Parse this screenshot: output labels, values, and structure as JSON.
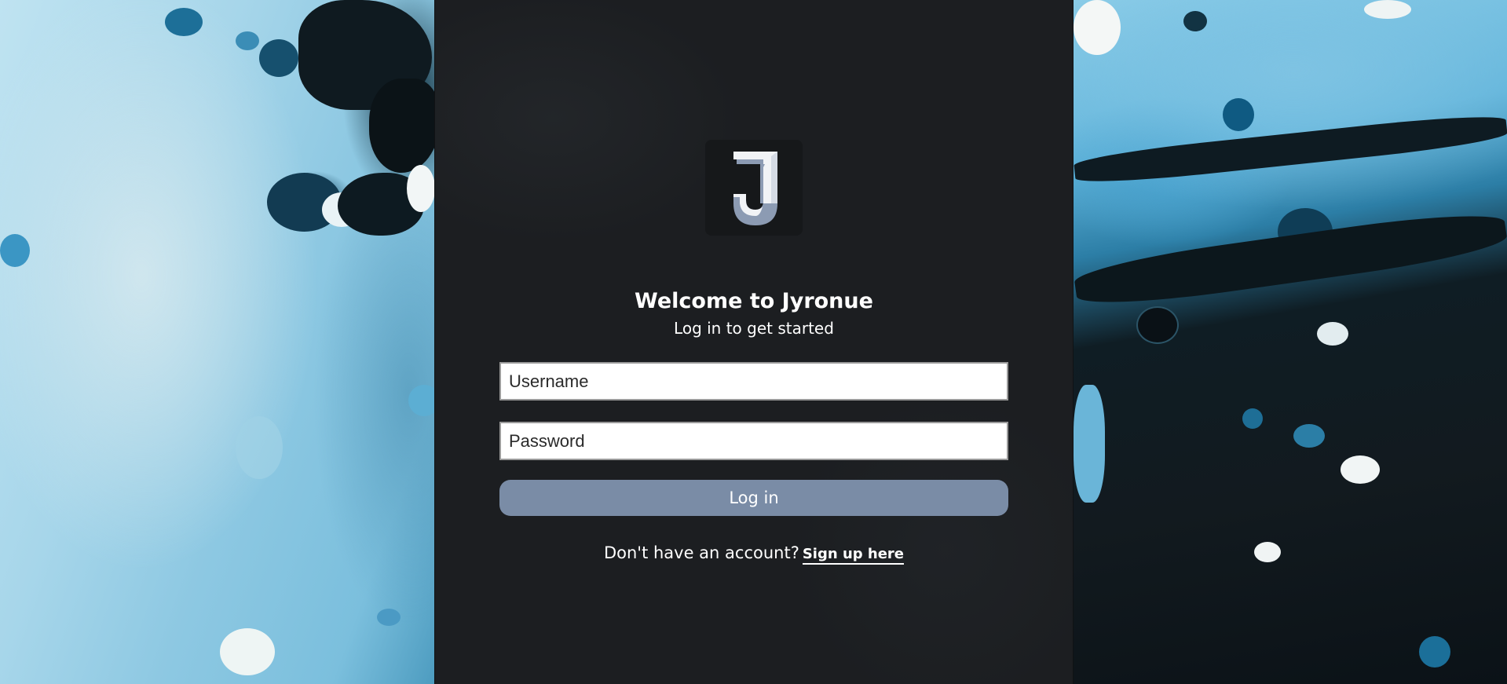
{
  "brand": {
    "logo_letter": "J",
    "logo_icon": "jyronue-logo-icon",
    "logo_colors": {
      "light": "#f1f3f6",
      "mid": "#8c9bb3",
      "dark": "#1a1c1f"
    }
  },
  "header": {
    "title": "Welcome to Jyronue",
    "subtitle": "Log in to get started"
  },
  "form": {
    "username_placeholder": "Username",
    "username_value": "",
    "password_placeholder": "Password",
    "password_value": "",
    "login_label": "Log in"
  },
  "signup": {
    "prompt": "Don't have an account?",
    "link_label": "Sign up here"
  },
  "colors": {
    "panel_background": "#1c1e21",
    "button_background": "#7a8ca6",
    "text": "#ffffff"
  }
}
